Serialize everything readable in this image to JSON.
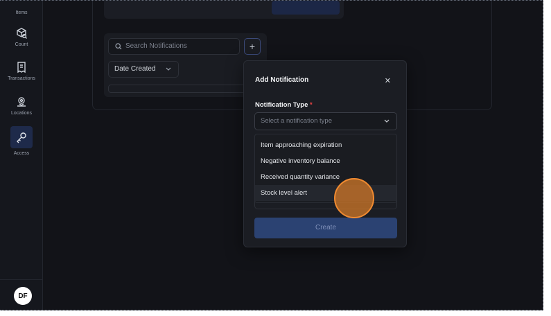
{
  "sidebar": {
    "items": [
      {
        "label": "Items"
      },
      {
        "label": "Count",
        "icon": "box-search-icon"
      },
      {
        "label": "Transactions",
        "icon": "receipt-icon"
      },
      {
        "label": "Locations",
        "icon": "location-pin-icon"
      },
      {
        "label": "Access",
        "icon": "key-icon"
      }
    ],
    "avatar_initials": "DF"
  },
  "filters": {
    "search_placeholder": "Search Notifications",
    "date_filter": "Date Created"
  },
  "modal": {
    "title": "Add Notification",
    "field_label": "Notification Type",
    "required_mark": "*",
    "select_placeholder": "Select a notification type",
    "options": [
      "Item approaching expiration",
      "Negative inventory balance",
      "Received quantity variance",
      "Stock level alert"
    ],
    "create_label": "Create"
  },
  "colors": {
    "background": "#13151b",
    "accent": "#2b4272",
    "required": "#ef4444",
    "cursor": "#f08a30"
  }
}
